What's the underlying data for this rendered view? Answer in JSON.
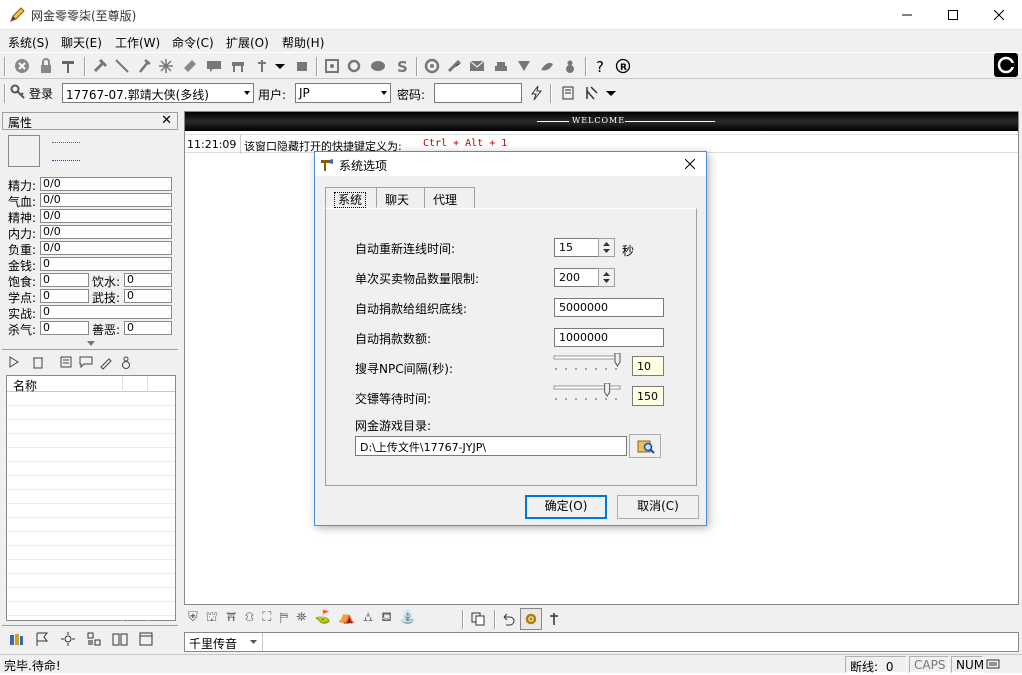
{
  "window": {
    "title": "网金零零柒(至尊版)"
  },
  "menu": [
    "系统(S)",
    "聊天(E)",
    "工作(W)",
    "命令(C)",
    "扩展(O)",
    "帮助(H)"
  ],
  "login": {
    "button": "登录",
    "server": "17767-07.郭靖大侠(多线)",
    "user_label": "用户:",
    "user_value": "JP",
    "pwd_label": "密码:"
  },
  "attrs": {
    "title": "属性",
    "rows": [
      {
        "label": "精力:",
        "value": "0/0"
      },
      {
        "label": "气血:",
        "value": "0/0"
      },
      {
        "label": "精神:",
        "value": "0/0"
      },
      {
        "label": "内力:",
        "value": "0/0"
      },
      {
        "label": "负重:",
        "value": "0/0"
      },
      {
        "label": "金钱:",
        "value": "0"
      }
    ],
    "pairs": [
      {
        "l1": "饱食:",
        "v1": "0",
        "l2": "饮水:",
        "v2": "0"
      },
      {
        "l1": "学点:",
        "v1": "0",
        "l2": "武技:",
        "v2": "0"
      }
    ],
    "shizhan_label": "实战:",
    "shizhan_value": "0",
    "shaqi_label": "杀气:",
    "shaqi_value": "0",
    "shane_label": "善恶:",
    "shane_value": "0"
  },
  "list": {
    "column": "名称"
  },
  "main": {
    "welcome": "WELCOME",
    "time": "11:21:09",
    "msg": "该窗口隐藏打开的快捷键定义为:",
    "hotkey": "Ctrl + Alt + 1"
  },
  "input": {
    "channel": "千里传音"
  },
  "status": {
    "text": "完毕.待命!",
    "disconnect_label": "断线:",
    "disconnect_value": "0",
    "caps": "CAPS",
    "num": "NUM"
  },
  "dialog": {
    "title": "系统选项",
    "tabs": [
      "系统",
      "聊天",
      "代理"
    ],
    "reconnect_label": "自动重新连线时间:",
    "reconnect_value": "15",
    "reconnect_unit": "秒",
    "trade_label": "单次买卖物品数量限制:",
    "trade_value": "200",
    "donate_floor_label": "自动捐款给组织底线:",
    "donate_floor_value": "5000000",
    "donate_amount_label": "自动捐款数额:",
    "donate_amount_value": "1000000",
    "npc_label": "搜寻NPC间隔(秒):",
    "npc_value": "10",
    "npc_level": 1.0,
    "wait_label": "交镖等待时间:",
    "wait_value": "150",
    "wait_level": 0.83,
    "dir_label": "网金游戏目录:",
    "dir_value": "D:\\上传文件\\17767-JYJP\\",
    "ok": "确定(O)",
    "cancel": "取消(C)"
  }
}
